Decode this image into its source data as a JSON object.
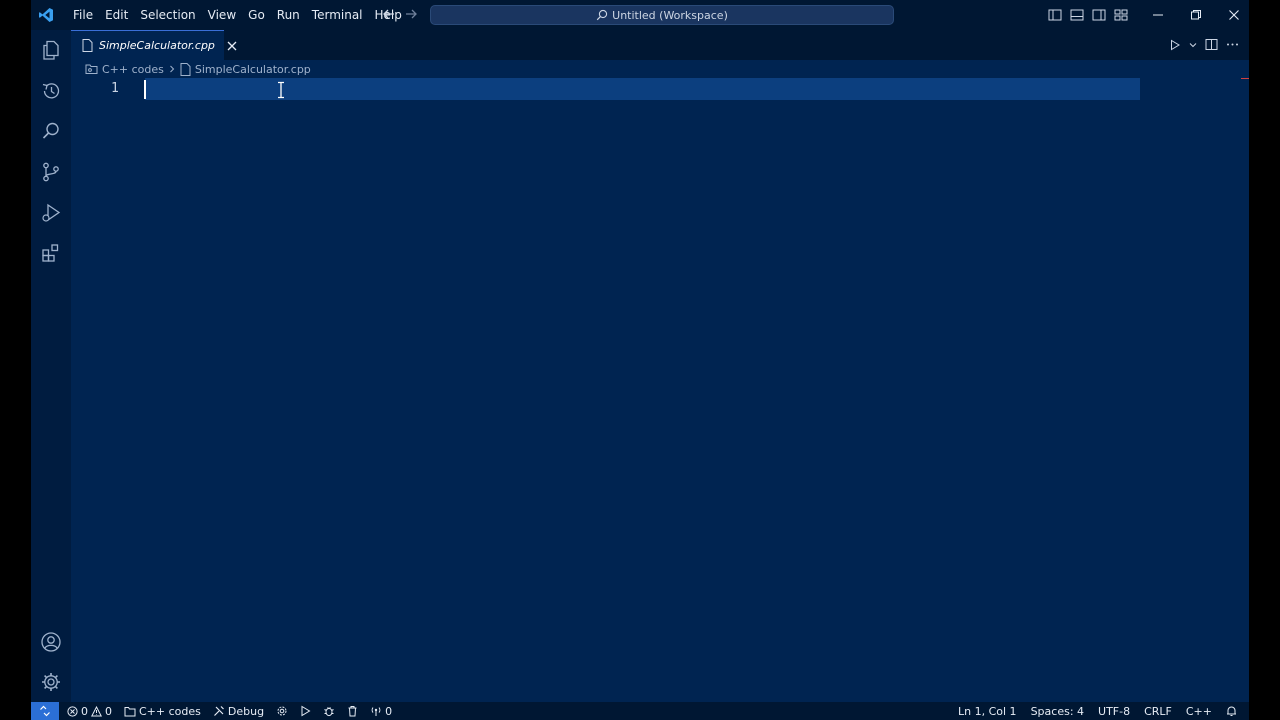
{
  "menu": {
    "items": [
      "File",
      "Edit",
      "Selection",
      "View",
      "Go",
      "Run",
      "Terminal",
      "Help"
    ]
  },
  "command_center": {
    "label": "Untitled (Workspace)"
  },
  "tab": {
    "label": "SimpleCalculator.cpp"
  },
  "breadcrumb": {
    "folder": "C++ codes",
    "file": "SimpleCalculator.cpp"
  },
  "editor": {
    "line_number": "1"
  },
  "statusbar": {
    "errors": "0",
    "warnings": "0",
    "folder": "C++ codes",
    "debug": "Debug",
    "ports": "0",
    "position": "Ln 1, Col 1",
    "spaces": "Spaces: 4",
    "encoding": "UTF-8",
    "eol": "CRLF",
    "language": "C++"
  },
  "colors": {
    "editor_bg": "#002451",
    "titlebar_bg": "#001733",
    "current_line": "#0c3f7f",
    "accent": "#2b6fd6"
  }
}
